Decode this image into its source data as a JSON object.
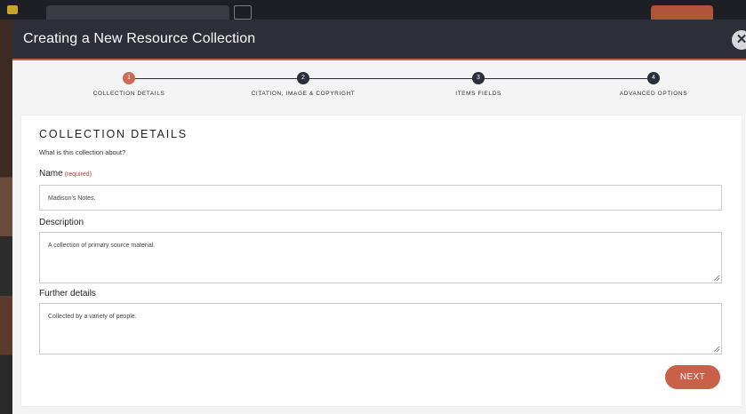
{
  "modal": {
    "title": "Creating a New Resource Collection",
    "close_icon": "close-icon"
  },
  "steps": [
    {
      "number": "1",
      "label": "COLLECTION DETAILS",
      "active": true
    },
    {
      "number": "2",
      "label": "CITATION, IMAGE & COPYRIGHT",
      "active": false
    },
    {
      "number": "3",
      "label": "ITEMS FIELDS",
      "active": false
    },
    {
      "number": "4",
      "label": "ADVANCED OPTIONS",
      "active": false
    }
  ],
  "section": {
    "title": "COLLECTION DETAILS",
    "subtitle": "What is this collection about?"
  },
  "fields": {
    "name": {
      "label": "Name",
      "required": "(required)",
      "value": "Madison's Notes."
    },
    "description": {
      "label": "Description",
      "value": "A collection of primary source material."
    },
    "further": {
      "label": "Further details",
      "value": "Collected by a variety of people."
    }
  },
  "actions": {
    "next_label": "NEXT"
  },
  "colors": {
    "accent": "#c8604a",
    "header_bg": "#2c2e38"
  }
}
